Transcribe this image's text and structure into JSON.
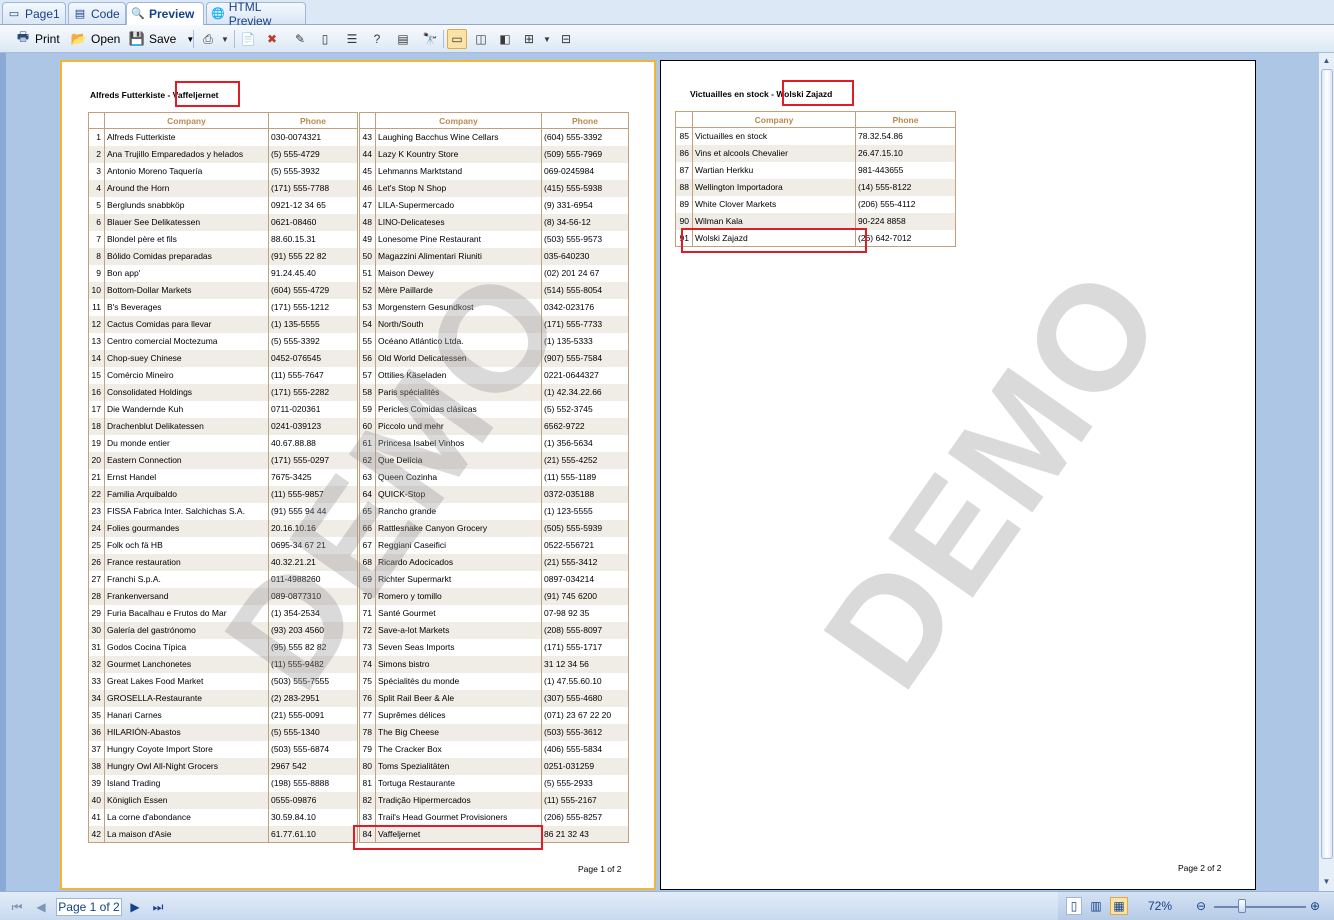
{
  "tabs": [
    {
      "label": "Page1",
      "icon": "page-icon"
    },
    {
      "label": "Code",
      "icon": "code-icon"
    },
    {
      "label": "Preview",
      "icon": "preview-icon"
    },
    {
      "label": "HTML Preview",
      "icon": "globe-icon"
    }
  ],
  "toolbar": {
    "print": "Print",
    "open": "Open",
    "save": "Save"
  },
  "page1": {
    "header_name": "Alfreds Futterkiste",
    "header_sep": " - ",
    "header_last": "Vaffeljernet",
    "page_label": "Page 1 of 2",
    "col_company": "Company",
    "col_phone": "Phone",
    "left": [
      [
        "1",
        "Alfreds Futterkiste",
        "030-0074321"
      ],
      [
        "2",
        "Ana Trujillo Emparedados y helados",
        "(5) 555-4729"
      ],
      [
        "3",
        "Antonio Moreno Taquería",
        "(5) 555-3932"
      ],
      [
        "4",
        "Around the Horn",
        "(171) 555-7788"
      ],
      [
        "5",
        "Berglunds snabbköp",
        "0921-12 34 65"
      ],
      [
        "6",
        "Blauer See Delikatessen",
        "0621-08460"
      ],
      [
        "7",
        "Blondel père et fils",
        "88.60.15.31"
      ],
      [
        "8",
        "Bólido Comidas preparadas",
        "(91) 555 22 82"
      ],
      [
        "9",
        "Bon app'",
        "91.24.45.40"
      ],
      [
        "10",
        "Bottom-Dollar Markets",
        "(604) 555-4729"
      ],
      [
        "11",
        "B's Beverages",
        "(171) 555-1212"
      ],
      [
        "12",
        "Cactus Comidas para llevar",
        "(1) 135-5555"
      ],
      [
        "13",
        "Centro comercial Moctezuma",
        "(5) 555-3392"
      ],
      [
        "14",
        "Chop-suey Chinese",
        "0452-076545"
      ],
      [
        "15",
        "Comércio Mineiro",
        "(11) 555-7647"
      ],
      [
        "16",
        "Consolidated Holdings",
        "(171) 555-2282"
      ],
      [
        "17",
        "Die Wandernde Kuh",
        "0711-020361"
      ],
      [
        "18",
        "Drachenblut Delikatessen",
        "0241-039123"
      ],
      [
        "19",
        "Du monde entier",
        "40.67.88.88"
      ],
      [
        "20",
        "Eastern Connection",
        "(171) 555-0297"
      ],
      [
        "21",
        "Ernst Handel",
        "7675-3425"
      ],
      [
        "22",
        "Familia Arquibaldo",
        "(11) 555-9857"
      ],
      [
        "23",
        "FISSA Fabrica Inter. Salchichas S.A.",
        "(91) 555 94 44"
      ],
      [
        "24",
        "Folies gourmandes",
        "20.16.10.16"
      ],
      [
        "25",
        "Folk och fä HB",
        "0695-34 67 21"
      ],
      [
        "26",
        "France restauration",
        "40.32.21.21"
      ],
      [
        "27",
        "Franchi S.p.A.",
        "011-4988260"
      ],
      [
        "28",
        "Frankenversand",
        "089-0877310"
      ],
      [
        "29",
        "Furia Bacalhau e Frutos do Mar",
        "(1) 354-2534"
      ],
      [
        "30",
        "Galería del gastrónomo",
        "(93) 203 4560"
      ],
      [
        "31",
        "Godos Cocina Típica",
        "(95) 555 82 82"
      ],
      [
        "32",
        "Gourmet Lanchonetes",
        "(11) 555-9482"
      ],
      [
        "33",
        "Great Lakes Food Market",
        "(503) 555-7555"
      ],
      [
        "34",
        "GROSELLA-Restaurante",
        "(2) 283-2951"
      ],
      [
        "35",
        "Hanari Carnes",
        "(21) 555-0091"
      ],
      [
        "36",
        "HILARIÓN-Abastos",
        "(5) 555-1340"
      ],
      [
        "37",
        "Hungry Coyote Import Store",
        "(503) 555-6874"
      ],
      [
        "38",
        "Hungry Owl All-Night Grocers",
        "2967 542"
      ],
      [
        "39",
        "Island Trading",
        "(198) 555-8888"
      ],
      [
        "40",
        "Königlich Essen",
        "0555-09876"
      ],
      [
        "41",
        "La corne d'abondance",
        "30.59.84.10"
      ],
      [
        "42",
        "La maison d'Asie",
        "61.77.61.10"
      ]
    ],
    "right": [
      [
        "43",
        "Laughing Bacchus Wine Cellars",
        "(604) 555-3392"
      ],
      [
        "44",
        "Lazy K Kountry Store",
        "(509) 555-7969"
      ],
      [
        "45",
        "Lehmanns Marktstand",
        "069-0245984"
      ],
      [
        "46",
        "Let's Stop N Shop",
        "(415) 555-5938"
      ],
      [
        "47",
        "LILA-Supermercado",
        "(9) 331-6954"
      ],
      [
        "48",
        "LINO-Delicateses",
        "(8) 34-56-12"
      ],
      [
        "49",
        "Lonesome Pine Restaurant",
        "(503) 555-9573"
      ],
      [
        "50",
        "Magazzini Alimentari Riuniti",
        "035-640230"
      ],
      [
        "51",
        "Maison Dewey",
        "(02) 201 24 67"
      ],
      [
        "52",
        "Mère Paillarde",
        "(514) 555-8054"
      ],
      [
        "53",
        "Morgenstern Gesundkost",
        "0342-023176"
      ],
      [
        "54",
        "North/South",
        "(171) 555-7733"
      ],
      [
        "55",
        "Océano Atlántico Ltda.",
        "(1) 135-5333"
      ],
      [
        "56",
        "Old World Delicatessen",
        "(907) 555-7584"
      ],
      [
        "57",
        "Ottilies Käseladen",
        "0221-0644327"
      ],
      [
        "58",
        "Paris spécialités",
        "(1) 42.34.22.66"
      ],
      [
        "59",
        "Pericles Comidas clásicas",
        "(5) 552-3745"
      ],
      [
        "60",
        "Piccolo und mehr",
        "6562-9722"
      ],
      [
        "61",
        "Princesa Isabel Vinhos",
        "(1) 356-5634"
      ],
      [
        "62",
        "Que Delícia",
        "(21) 555-4252"
      ],
      [
        "63",
        "Queen Cozinha",
        "(11) 555-1189"
      ],
      [
        "64",
        "QUICK-Stop",
        "0372-035188"
      ],
      [
        "65",
        "Rancho grande",
        "(1) 123-5555"
      ],
      [
        "66",
        "Rattlesnake Canyon Grocery",
        "(505) 555-5939"
      ],
      [
        "67",
        "Reggiani Caseifici",
        "0522-556721"
      ],
      [
        "68",
        "Ricardo Adocicados",
        "(21) 555-3412"
      ],
      [
        "69",
        "Richter Supermarkt",
        "0897-034214"
      ],
      [
        "70",
        "Romero y tomillo",
        "(91) 745 6200"
      ],
      [
        "71",
        "Santé Gourmet",
        "07-98 92 35"
      ],
      [
        "72",
        "Save-a-lot Markets",
        "(208) 555-8097"
      ],
      [
        "73",
        "Seven Seas Imports",
        "(171) 555-1717"
      ],
      [
        "74",
        "Simons bistro",
        "31 12 34 56"
      ],
      [
        "75",
        "Spécialités du monde",
        "(1) 47.55.60.10"
      ],
      [
        "76",
        "Split Rail Beer & Ale",
        "(307) 555-4680"
      ],
      [
        "77",
        "Suprêmes délices",
        "(071) 23 67 22 20"
      ],
      [
        "78",
        "The Big Cheese",
        "(503) 555-3612"
      ],
      [
        "79",
        "The Cracker Box",
        "(406) 555-5834"
      ],
      [
        "80",
        "Toms Spezialitäten",
        "0251-031259"
      ],
      [
        "81",
        "Tortuga Restaurante",
        "(5) 555-2933"
      ],
      [
        "82",
        "Tradição Hipermercados",
        "(11) 555-2167"
      ],
      [
        "83",
        "Trail's Head Gourmet Provisioners",
        "(206) 555-8257"
      ],
      [
        "84",
        "Vaffeljernet",
        "86 21 32 43"
      ]
    ]
  },
  "page2": {
    "header_name": "Victuailles en stock",
    "header_sep": " - ",
    "header_last": "Wolski  Zajazd",
    "page_label": "Page 2 of 2",
    "col_company": "Company",
    "col_phone": "Phone",
    "rows": [
      [
        "85",
        "Victuailles en stock",
        "78.32.54.86"
      ],
      [
        "86",
        "Vins et alcools Chevalier",
        "26.47.15.10"
      ],
      [
        "87",
        "Wartian Herkku",
        "981-443655"
      ],
      [
        "88",
        "Wellington Importadora",
        "(14) 555-8122"
      ],
      [
        "89",
        "White Clover Markets",
        "(206) 555-4112"
      ],
      [
        "90",
        "Wilman Kala",
        "90-224 8858"
      ],
      [
        "91",
        "Wolski  Zajazd",
        "(26) 642-7012"
      ]
    ]
  },
  "watermark": "DEMO",
  "status": {
    "page": "Page 1 of 2",
    "zoom": "72%"
  },
  "colors": {
    "highlight": "#e01d26",
    "header_text": "#b98a4e",
    "selected_page": "#f5b534"
  }
}
